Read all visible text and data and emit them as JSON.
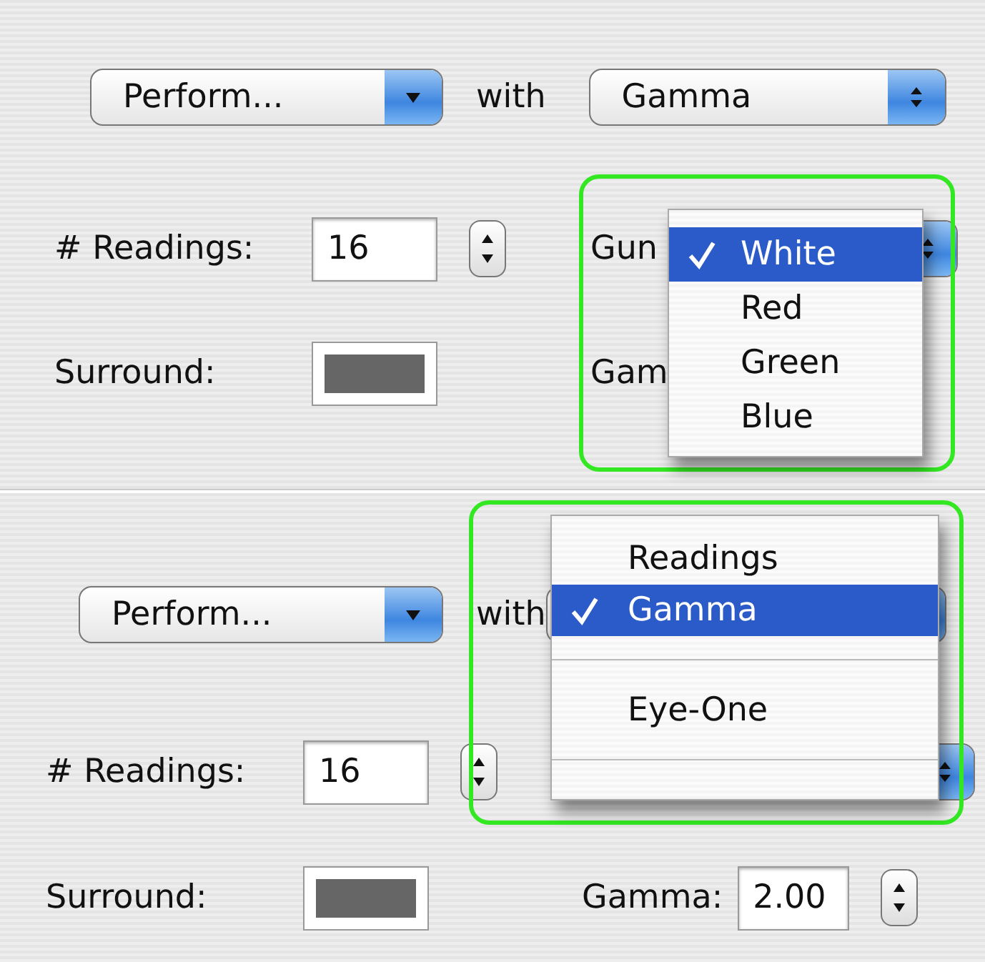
{
  "panels": [
    {
      "action_popup": {
        "value": "Perform..."
      },
      "with_label": "with",
      "source_popup": {
        "value": "Gamma"
      },
      "rows": [
        {
          "label": "# Readings:",
          "kind": "stepper",
          "value": "16",
          "right": {
            "kind": "popup",
            "label": "Gun"
          }
        },
        {
          "label": "Surround:",
          "kind": "swatch",
          "right": {
            "kind": "label",
            "label": "Gam"
          }
        }
      ],
      "menu": {
        "items": [
          {
            "kind": "item",
            "label": "White",
            "selected": true
          },
          {
            "kind": "item",
            "label": "Red",
            "selected": false
          },
          {
            "kind": "item",
            "label": "Green",
            "selected": false
          },
          {
            "kind": "item",
            "label": "Blue",
            "selected": false
          }
        ]
      }
    },
    {
      "action_popup": {
        "value": "Perform..."
      },
      "with_label": "with",
      "rows": [
        {
          "label": "# Readings:",
          "kind": "stepper",
          "value": "16",
          "right": {
            "kind": "popup"
          }
        },
        {
          "label": "Surround:",
          "kind": "swatch",
          "right": {
            "kind": "stepper",
            "label": "Gamma:",
            "value": "2.00"
          }
        }
      ],
      "menu": {
        "items": [
          {
            "kind": "item",
            "label": "Readings",
            "selected": false
          },
          {
            "kind": "item",
            "label": "Gamma",
            "selected": true
          },
          {
            "kind": "separator"
          },
          {
            "kind": "item",
            "label": "Eye-One",
            "selected": false
          },
          {
            "kind": "separator"
          }
        ]
      }
    }
  ]
}
